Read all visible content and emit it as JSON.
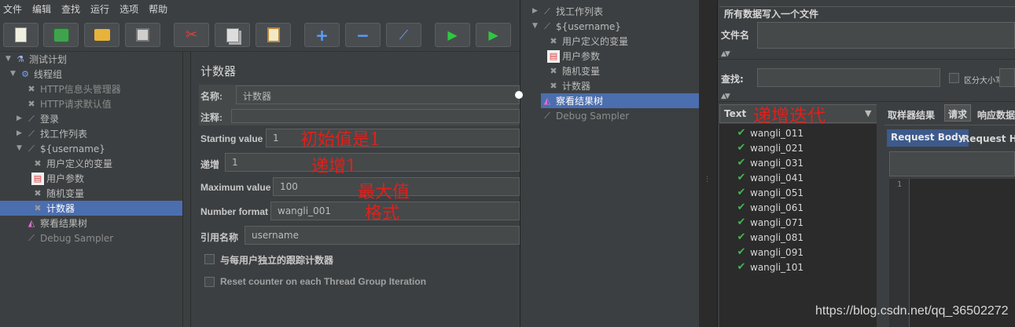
{
  "menu": [
    "文件",
    "编辑",
    "查找",
    "运行",
    "选项",
    "帮助"
  ],
  "toolbar": [
    {
      "name": "new",
      "glyph": "📄"
    },
    {
      "name": "templates",
      "glyph": "🗂"
    },
    {
      "name": "open",
      "glyph": "📂"
    },
    {
      "name": "save",
      "glyph": "💾"
    },
    {
      "name": "cut",
      "glyph": "✂"
    },
    {
      "name": "copy",
      "glyph": "⎘"
    },
    {
      "name": "paste",
      "glyph": "📋"
    },
    {
      "name": "expand",
      "glyph": "+"
    },
    {
      "name": "collapse",
      "glyph": "−"
    },
    {
      "name": "toggle",
      "glyph": "⟋"
    },
    {
      "name": "start",
      "glyph": "▶"
    },
    {
      "name": "start-no-pause",
      "glyph": "▶"
    }
  ],
  "left_tree": [
    {
      "label": "测试计划",
      "icon": "flask-icon",
      "glyph": "⚗",
      "arrow": "▼"
    },
    {
      "label": "线程组",
      "icon": "gear-icon",
      "glyph": "⚙",
      "arrow": "▼"
    },
    {
      "label": "HTTP信息头管理器",
      "icon": "wrench-icon",
      "glyph": "✖",
      "arrow": "",
      "grey": true
    },
    {
      "label": "HTTP请求默认值",
      "icon": "wrench-icon",
      "glyph": "✖",
      "arrow": "",
      "grey": true
    },
    {
      "label": "登录",
      "icon": "pipette-icon",
      "glyph": "⟋",
      "arrow": "▶"
    },
    {
      "label": "找工作列表",
      "icon": "pipette-icon",
      "glyph": "⟋",
      "arrow": "▶"
    },
    {
      "label": "${username}",
      "icon": "pipette-icon",
      "glyph": "⟋",
      "arrow": "▼"
    },
    {
      "label": "用户定义的变量",
      "icon": "wrench-icon",
      "glyph": "✖",
      "arrow": ""
    },
    {
      "label": "用户参数",
      "icon": "doc-icon",
      "glyph": "▤",
      "arrow": ""
    },
    {
      "label": "随机变量",
      "icon": "wrench-icon",
      "glyph": "✖",
      "arrow": ""
    },
    {
      "label": "计数器",
      "icon": "wrench-icon",
      "glyph": "✖",
      "arrow": "",
      "selected": true
    },
    {
      "label": "察看结果树",
      "icon": "chart-icon",
      "glyph": "◭",
      "arrow": ""
    },
    {
      "label": "Debug Sampler",
      "icon": "pipette-icon",
      "glyph": "⟋",
      "arrow": "",
      "grey": true
    }
  ],
  "counter": {
    "title": "计数器",
    "name_label": "名称:",
    "name_value": "计数器",
    "comment_label": "注释:",
    "comment_value": "",
    "start_label": "Starting value",
    "start_value": "1",
    "incr_label": "递增",
    "incr_value": "1",
    "max_label": "Maximum value",
    "max_value": "100",
    "format_label": "Number format",
    "format_value": "wangli_001",
    "ref_label": "引用名称",
    "ref_value": "username",
    "chk1": "与每用户独立的跟踪计数器",
    "chk2": "Reset counter on each Thread Group Iteration"
  },
  "annotations": {
    "start": "初始值是1",
    "incr": "递增1",
    "max": "最大值",
    "format": "格式",
    "iter": "递增迭代"
  },
  "mid_tree": [
    {
      "label": "找工作列表",
      "icon": "pipette-icon",
      "glyph": "⟋",
      "arrow": "▶"
    },
    {
      "label": "${username}",
      "icon": "pipette-icon",
      "glyph": "⟋",
      "arrow": "▼"
    },
    {
      "label": "用户定义的变量",
      "icon": "wrench-icon",
      "glyph": "✖",
      "arrow": ""
    },
    {
      "label": "用户参数",
      "icon": "doc-icon",
      "glyph": "▤",
      "arrow": ""
    },
    {
      "label": "随机变量",
      "icon": "wrench-icon",
      "glyph": "✖",
      "arrow": ""
    },
    {
      "label": "计数器",
      "icon": "wrench-icon",
      "glyph": "✖",
      "arrow": ""
    },
    {
      "label": "察看结果树",
      "icon": "chart-icon",
      "glyph": "◭",
      "arrow": "",
      "selected": true
    },
    {
      "label": "Debug Sampler",
      "icon": "pipette-icon",
      "glyph": "⟋",
      "arrow": "",
      "grey": true
    }
  ],
  "results": {
    "write_all": "所有数据写入一个文件",
    "filename_label": "文件名",
    "filename_value": "",
    "search_label": "查找:",
    "search_value": "",
    "case_label": "区分大小写",
    "renderer": "Text",
    "tabs": [
      "取样器结果",
      "请求",
      "响应数据"
    ],
    "subtabs": [
      "Request Body",
      "Request Headers"
    ],
    "line_no": "1",
    "samples": [
      "wangli_011",
      "wangli_021",
      "wangli_031",
      "wangli_041",
      "wangli_051",
      "wangli_061",
      "wangli_071",
      "wangli_081",
      "wangli_091",
      "wangli_101"
    ]
  },
  "watermark": "https://blog.csdn.net/qq_36502272",
  "colors": {
    "selection": "#4b6eaf",
    "annotation": "#e0201a",
    "success": "#3fb950"
  }
}
